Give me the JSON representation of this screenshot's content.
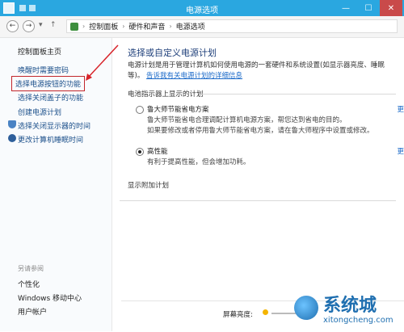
{
  "window": {
    "title": "电源选项"
  },
  "address": {
    "crumbs": [
      "控制面板",
      "硬件和声音",
      "电源选项"
    ]
  },
  "sidebar": {
    "home": "控制面板主页",
    "items": [
      "唤醒时需要密码",
      "选择电源按钮的功能",
      "选择关闭盖子的功能",
      "创建电源计划",
      "选择关闭显示器的时间",
      "更改计算机睡眠时间"
    ],
    "see_also_title": "另请参阅",
    "see_also": [
      "个性化",
      "Windows 移动中心",
      "用户帐户"
    ]
  },
  "main": {
    "heading": "选择或自定义电源计划",
    "description": "电源计划是用于管理计算机如何使用电源的一套硬件和系统设置(如显示器亮度、睡眠等)。",
    "description_link": "告诉我有关电源计划的详细信息",
    "battery_section": "电池指示器上显示的计划",
    "plans": [
      {
        "name": "鲁大师节能省电方案",
        "desc1": "鲁大师节能省电合理调配计算机电源方案，帮您达到省电的目的。",
        "desc2": "如果要修改或者停用鲁大师节能省电方案，请在鲁大师程序中设置或修改。",
        "selected": false,
        "more": "更"
      },
      {
        "name": "高性能",
        "desc1": "有利于提高性能，但会增加功耗。",
        "selected": true,
        "more": "更"
      }
    ],
    "extra_section": "显示附加计划"
  },
  "bottom": {
    "brightness_label": "屏幕亮度:"
  },
  "watermark": {
    "text": "系统城",
    "url": "xitongcheng.com"
  },
  "colors": {
    "titlebar": "#2aa7e0",
    "link": "#1b6ac9",
    "highlight_border": "#c2262b",
    "arrow": "#d8232a"
  }
}
